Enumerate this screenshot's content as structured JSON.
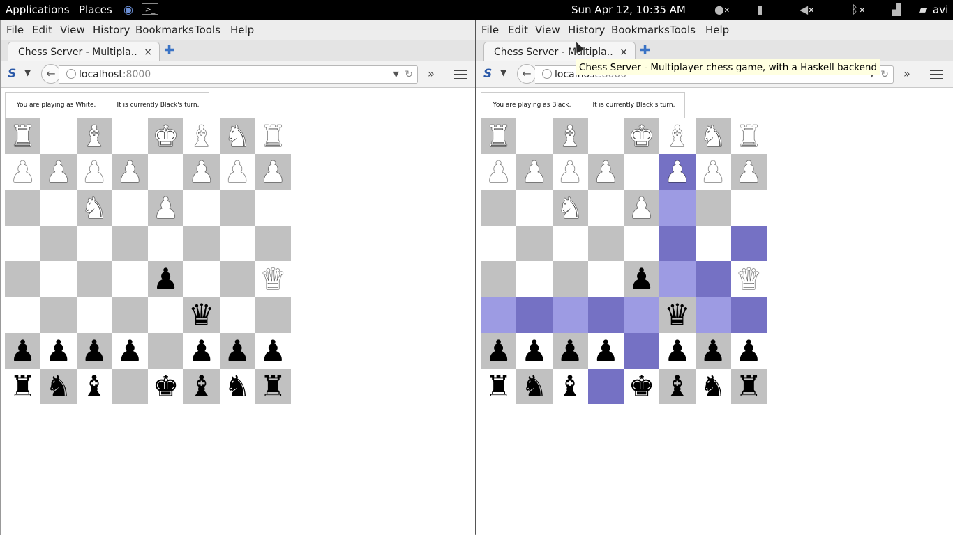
{
  "topbar": {
    "applications": "Applications",
    "places": "Places",
    "clock": "Sun Apr 12, 10:35 AM",
    "user": "avi",
    "icons": [
      "browser-globe-icon",
      "terminal-icon",
      "mic-muted-icon",
      "battery-icon",
      "volume-muted-icon",
      "bluetooth-off-icon",
      "signal-icon",
      "chat-icon"
    ]
  },
  "windows": [
    {
      "menu": [
        "File",
        "Edit",
        "View",
        "History",
        "Bookmarks",
        "Tools",
        "Help"
      ],
      "tab_title": "Chess Server - Multipla...",
      "tab_close": "×",
      "new_tab": "✚",
      "url_host": "localhost",
      "url_port": ":8000",
      "status": {
        "player": "You are playing as White.",
        "turn": "It is currently Black's turn."
      },
      "board": [
        [
          "wR",
          "",
          "wB",
          "",
          "wK",
          "wB",
          "wN",
          "wR"
        ],
        [
          "wP",
          "wP",
          "wP",
          "wP",
          "",
          "wP",
          "wP",
          "wP"
        ],
        [
          "",
          "",
          "wN",
          "",
          "wP",
          "",
          "",
          ""
        ],
        [
          "",
          "",
          "",
          "",
          "",
          "",
          "",
          ""
        ],
        [
          "",
          "",
          "",
          "",
          "bP",
          "",
          "",
          "wQ"
        ],
        [
          "",
          "",
          "",
          "",
          "",
          "bQ",
          "",
          ""
        ],
        [
          "bP",
          "bP",
          "bP",
          "bP",
          "",
          "bP",
          "bP",
          "bP"
        ],
        [
          "bR",
          "bN",
          "bB",
          "",
          "bK",
          "bB",
          "bN",
          "bR"
        ]
      ],
      "highlights": []
    },
    {
      "menu": [
        "File",
        "Edit",
        "View",
        "History",
        "Bookmarks",
        "Tools",
        "Help"
      ],
      "tab_title": "Chess Server - Multipla...",
      "tab_close": "×",
      "new_tab": "✚",
      "url_host": "localhost",
      "url_port": ":8000",
      "status": {
        "player": "You are playing as Black.",
        "turn": "It is currently Black's turn."
      },
      "board": [
        [
          "wR",
          "",
          "wB",
          "",
          "wK",
          "wB",
          "wN",
          "wR"
        ],
        [
          "wP",
          "wP",
          "wP",
          "wP",
          "",
          "wP",
          "wP",
          "wP"
        ],
        [
          "",
          "",
          "wN",
          "",
          "wP",
          "",
          "",
          ""
        ],
        [
          "",
          "",
          "",
          "",
          "",
          "",
          "",
          ""
        ],
        [
          "",
          "",
          "",
          "",
          "bP",
          "",
          "",
          "wQ"
        ],
        [
          "",
          "",
          "",
          "",
          "",
          "bQ",
          "",
          ""
        ],
        [
          "bP",
          "bP",
          "bP",
          "bP",
          "",
          "bP",
          "bP",
          "bP"
        ],
        [
          "bR",
          "bN",
          "bB",
          "",
          "bK",
          "bB",
          "bN",
          "bR"
        ]
      ],
      "highlights": [
        [
          1,
          5
        ],
        [
          2,
          5
        ],
        [
          3,
          5
        ],
        [
          3,
          7
        ],
        [
          4,
          5
        ],
        [
          4,
          6
        ],
        [
          5,
          0
        ],
        [
          5,
          1
        ],
        [
          5,
          2
        ],
        [
          5,
          3
        ],
        [
          5,
          4
        ],
        [
          5,
          6
        ],
        [
          5,
          7
        ],
        [
          6,
          4
        ],
        [
          7,
          3
        ]
      ]
    }
  ],
  "tooltip": "Chess Server - Multiplayer chess game, with a Haskell backend",
  "glyphs": {
    "K": "♚",
    "Q": "♛",
    "R": "♜",
    "B": "♝",
    "N": "♞",
    "P": "♟",
    "wK": "♔",
    "wQ": "♕",
    "wR": "♖",
    "wB": "♗",
    "wN": "♘",
    "wP": "♙"
  }
}
